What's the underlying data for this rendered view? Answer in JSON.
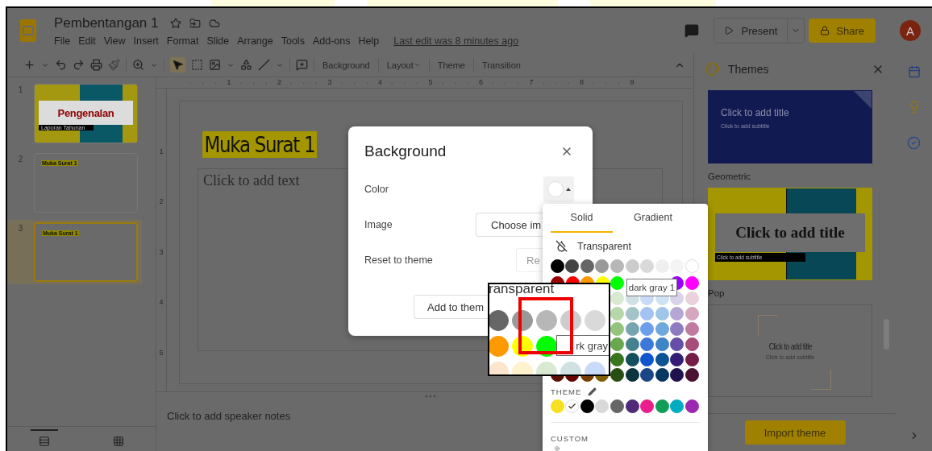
{
  "app": {
    "title": "Pembentangan 1",
    "menu": [
      "File",
      "Edit",
      "View",
      "Insert",
      "Format",
      "Slide",
      "Arrange",
      "Tools",
      "Add-ons",
      "Help"
    ],
    "last_edit": "Last edit was 8 minutes ago",
    "present": "Present",
    "share": "Share",
    "avatar": "A"
  },
  "toolbar": {
    "buttons": [
      {
        "label": "Background",
        "menu": false
      },
      {
        "label": "Layout",
        "menu": true
      },
      {
        "label": "Theme",
        "menu": false
      },
      {
        "label": "Transition",
        "menu": false
      }
    ]
  },
  "filmstrip": {
    "slides": [
      {
        "number": "1",
        "kind": "title",
        "title": "Pengenalan",
        "subtitle": "Laporan Tahunan",
        "selected": false
      },
      {
        "number": "2",
        "kind": "content",
        "title": "Muka Surat 1",
        "selected": false
      },
      {
        "number": "3",
        "kind": "content",
        "title": "Muka Surat 1",
        "selected": true
      }
    ]
  },
  "ruler": {
    "horizontal": [
      "1",
      "2",
      "3",
      "4",
      "5",
      "6",
      "7",
      "8",
      "9"
    ],
    "vertical": [
      "1",
      "2",
      "3",
      "4",
      "5"
    ]
  },
  "slide": {
    "title": "Muka Surat 1",
    "body_placeholder": "Click to add text"
  },
  "notes": {
    "placeholder": "Click to add speaker notes"
  },
  "themes_panel": {
    "title": "Themes",
    "themes": [
      {
        "kind": "dark",
        "title": "Click to add title",
        "subtitle": "Click to add subtitle"
      },
      {
        "kind": "geometric",
        "name": "Geometric",
        "title": "Click to add title",
        "subtitle": "Click to add subtitle"
      },
      {
        "kind": "pop",
        "name": "Pop",
        "title": "Click to add title",
        "subtitle": "Click to add subtitle"
      }
    ],
    "import_button": "Import theme"
  },
  "dialog": {
    "title": "Background",
    "rows": [
      {
        "kind": "color",
        "label": "Color"
      },
      {
        "kind": "button",
        "label": "Image",
        "button": "Choose im",
        "disabled": false
      },
      {
        "kind": "button",
        "label": "Reset to theme",
        "button": "Re",
        "disabled": true
      }
    ],
    "add_button": "Add to them"
  },
  "color_picker": {
    "tabs": [
      {
        "label": "Solid",
        "selected": true
      },
      {
        "label": "Gradient",
        "selected": false
      }
    ],
    "transparent": "Transparent",
    "palette": [
      {
        "kind": "full",
        "swatches": [
          {
            "color": "#000000"
          },
          {
            "color": "#434343"
          },
          {
            "color": "#666666"
          },
          {
            "color": "#999999"
          },
          {
            "color": "#b7b7b7"
          },
          {
            "color": "#cccccc"
          },
          {
            "color": "#d9d9d9"
          },
          {
            "color": "#efefef"
          },
          {
            "color": "#f3f3f3"
          },
          {
            "color": "#ffffff"
          }
        ]
      },
      {
        "kind": "split",
        "left": [
          {
            "color": "#980000"
          },
          {
            "color": "#ff0000"
          },
          {
            "color": "#ff9900"
          },
          {
            "color": "#ffff00"
          },
          {
            "color": "#00ff00"
          }
        ],
        "right": [
          {
            "color": "#9900ff"
          },
          {
            "color": "#ff00ff"
          }
        ]
      },
      {
        "kind": "right",
        "swatches": [
          {
            "color": "#d9ead3"
          },
          {
            "color": "#d0e0e3"
          },
          {
            "color": "#c9daf8"
          },
          {
            "color": "#cfe2f3"
          },
          {
            "color": "#d9d2e9"
          },
          {
            "color": "#ead1dc"
          }
        ]
      },
      {
        "kind": "right",
        "swatches": [
          {
            "color": "#b6d7a8"
          },
          {
            "color": "#a2c4c9"
          },
          {
            "color": "#a4c2f4"
          },
          {
            "color": "#9fc5e8"
          },
          {
            "color": "#b4a7d6"
          },
          {
            "color": "#d5a6bd"
          }
        ]
      },
      {
        "kind": "right",
        "swatches": [
          {
            "color": "#93c47d"
          },
          {
            "color": "#76a5af"
          },
          {
            "color": "#6d9eeb"
          },
          {
            "color": "#6fa8dc"
          },
          {
            "color": "#8e7cc3"
          },
          {
            "color": "#c27ba0"
          }
        ]
      },
      {
        "kind": "right",
        "swatches": [
          {
            "color": "#6aa84f"
          },
          {
            "color": "#45818e"
          },
          {
            "color": "#3c78d8"
          },
          {
            "color": "#3d85c6"
          },
          {
            "color": "#674ea7"
          },
          {
            "color": "#a64d79"
          }
        ]
      },
      {
        "kind": "right",
        "swatches": [
          {
            "color": "#38761d"
          },
          {
            "color": "#134f5c"
          },
          {
            "color": "#1155cc"
          },
          {
            "color": "#0b5394"
          },
          {
            "color": "#351c75"
          },
          {
            "color": "#741b47"
          }
        ]
      },
      {
        "kind": "full",
        "swatches": [
          {
            "color": "#5b0f00"
          },
          {
            "color": "#660000"
          },
          {
            "color": "#783f04"
          },
          {
            "color": "#7f6000"
          },
          {
            "color": "#274e13"
          },
          {
            "color": "#0c343d"
          },
          {
            "color": "#1c4587"
          },
          {
            "color": "#073763"
          },
          {
            "color": "#20124d"
          },
          {
            "color": "#4c1130"
          }
        ]
      }
    ],
    "tooltip": "dark gray 1",
    "theme_label": "THEME",
    "theme_colors": [
      {
        "color": "#f6e01f",
        "selected": false
      },
      {
        "color": "#ffffff",
        "selected": true
      },
      {
        "color": "#000000",
        "selected": false
      },
      {
        "color": "#d9d9d9",
        "selected": false
      },
      {
        "color": "#666666",
        "selected": false
      },
      {
        "color": "#4e2a78",
        "selected": false
      },
      {
        "color": "#e91e8c",
        "selected": false
      },
      {
        "color": "#0f9d58",
        "selected": false
      },
      {
        "color": "#00acc1",
        "selected": false
      },
      {
        "color": "#9c27b0",
        "selected": false
      }
    ],
    "custom_label": "CUSTOM"
  },
  "magnifier": {
    "caption": "ransparent",
    "rows": [
      [
        {
          "color": "#666666"
        },
        {
          "color": "#999999"
        },
        {
          "color": "#b7b7b7"
        },
        {
          "color": "#cccccc"
        },
        {
          "color": "#d9d9d9"
        }
      ],
      [
        {
          "color": "#ff9900"
        },
        {
          "color": "#ffff00"
        },
        {
          "color": "#00ff00"
        }
      ],
      [
        {
          "color": "#fce5cd"
        },
        {
          "color": "#fff2cc"
        },
        {
          "color": "#d9ead3"
        },
        {
          "color": "#d0e0e3"
        },
        {
          "color": "#c9daf8"
        }
      ]
    ],
    "tooltip": "rk gray"
  }
}
